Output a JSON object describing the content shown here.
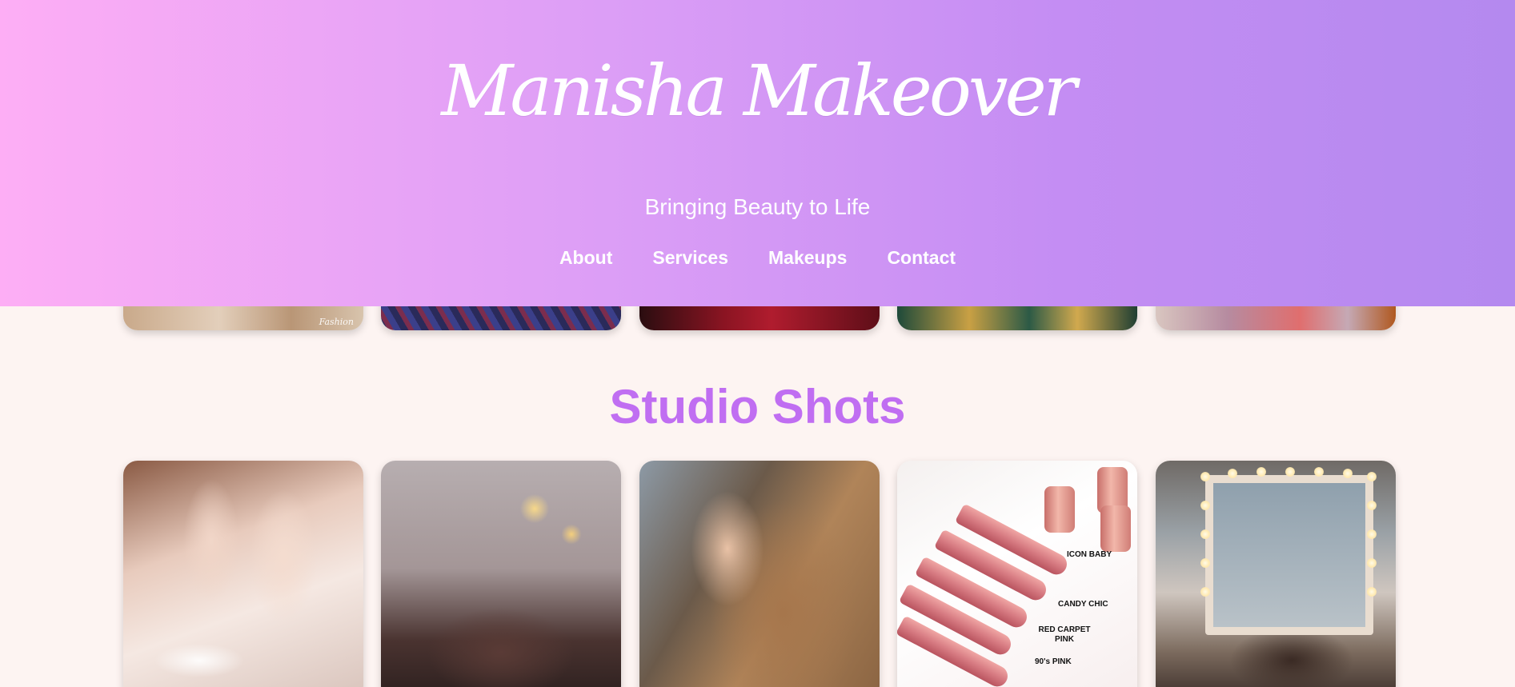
{
  "header": {
    "brand": "Manisha Makeover",
    "tagline": "Bringing Beauty to Life",
    "nav": [
      "About",
      "Services",
      "Makeups",
      "Contact"
    ]
  },
  "gallery_prev": {
    "watermark": "Fashion"
  },
  "studio": {
    "title": "Studio Shots",
    "shots": [
      {
        "subject": "nails"
      },
      {
        "subject": "salon"
      },
      {
        "subject": "hair"
      },
      {
        "subject": "lipsticks",
        "labels": [
          "ICON BABY",
          "CANDY CHIC",
          "RED CARPET PINK",
          "90's PINK"
        ]
      },
      {
        "subject": "vanity"
      }
    ]
  },
  "colors": {
    "header_gradient_start": "#fdaef5",
    "header_gradient_end": "#b489ef",
    "section_title": "#c06ef2",
    "page_background": "#fdf4f2"
  }
}
